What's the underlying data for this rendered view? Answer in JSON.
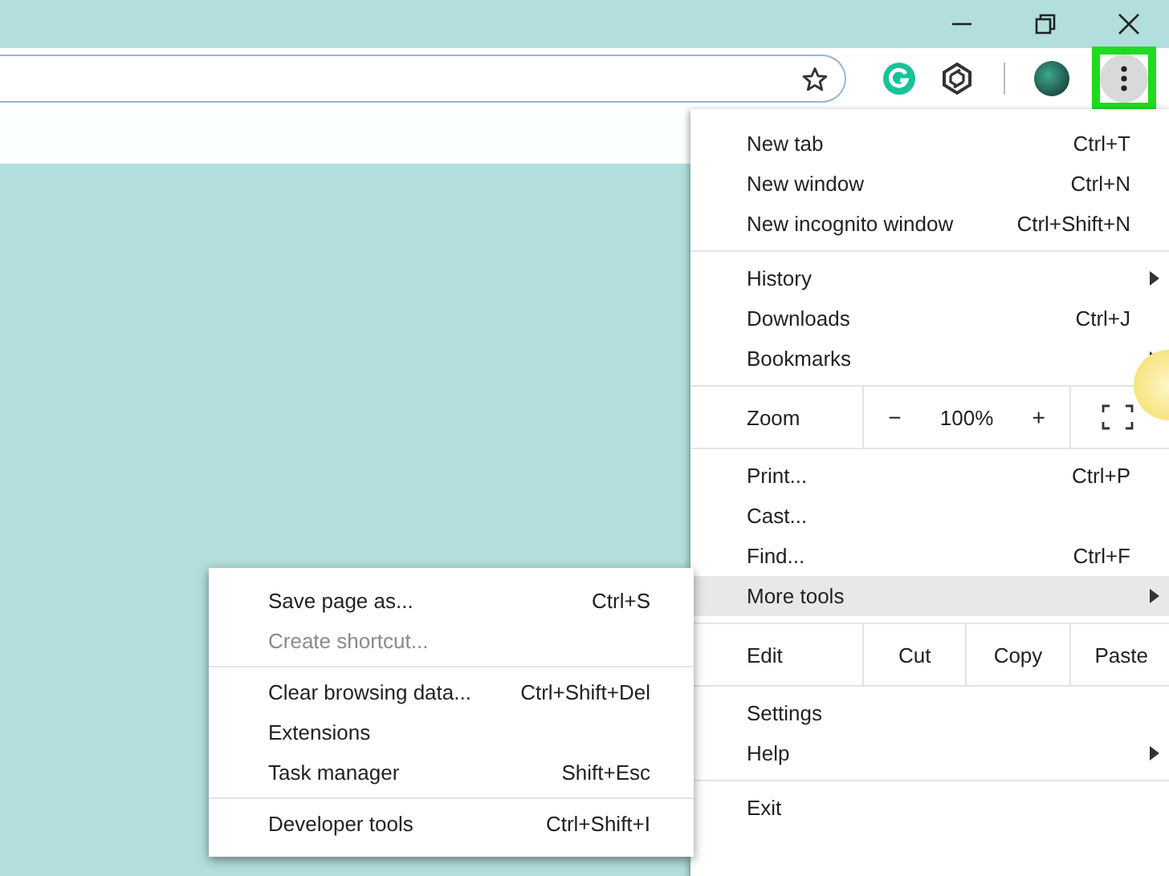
{
  "toolbar": {
    "menu_button": {
      "highlighted": true
    }
  },
  "menu": {
    "sections": [
      [
        {
          "kind": "item",
          "label": "New tab",
          "shortcut": "Ctrl+T",
          "submenu": false,
          "selected": false
        },
        {
          "kind": "item",
          "label": "New window",
          "shortcut": "Ctrl+N",
          "submenu": false,
          "selected": false
        },
        {
          "kind": "item",
          "label": "New incognito window",
          "shortcut": "Ctrl+Shift+N",
          "submenu": false,
          "selected": false
        }
      ],
      [
        {
          "kind": "item",
          "label": "History",
          "submenu": true,
          "selected": false
        },
        {
          "kind": "item",
          "label": "Downloads",
          "shortcut": "Ctrl+J",
          "submenu": false,
          "selected": false
        },
        {
          "kind": "item",
          "label": "Bookmarks",
          "submenu": true,
          "selected": false
        }
      ],
      [
        {
          "kind": "zoom",
          "label": "Zoom",
          "minus": "−",
          "value": "100%",
          "plus": "+"
        }
      ],
      [
        {
          "kind": "item",
          "label": "Print...",
          "shortcut": "Ctrl+P",
          "submenu": false,
          "selected": false
        },
        {
          "kind": "item",
          "label": "Cast...",
          "submenu": false,
          "selected": false
        },
        {
          "kind": "item",
          "label": "Find...",
          "shortcut": "Ctrl+F",
          "submenu": false,
          "selected": false
        },
        {
          "kind": "item",
          "label": "More tools",
          "submenu": true,
          "selected": true
        }
      ],
      [
        {
          "kind": "edit",
          "label": "Edit",
          "actions": [
            "Cut",
            "Copy",
            "Paste"
          ]
        }
      ],
      [
        {
          "kind": "item",
          "label": "Settings",
          "submenu": false,
          "selected": false
        },
        {
          "kind": "item",
          "label": "Help",
          "submenu": true,
          "selected": false
        }
      ],
      [
        {
          "kind": "item",
          "label": "Exit",
          "submenu": false,
          "selected": false
        }
      ]
    ]
  },
  "submenu": {
    "sections": [
      [
        {
          "label": "Save page as...",
          "shortcut": "Ctrl+S",
          "disabled": false
        },
        {
          "label": "Create shortcut...",
          "disabled": true
        }
      ],
      [
        {
          "label": "Clear browsing data...",
          "shortcut": "Ctrl+Shift+Del",
          "disabled": false
        },
        {
          "label": "Extensions",
          "disabled": false
        },
        {
          "label": "Task manager",
          "shortcut": "Shift+Esc",
          "disabled": false
        }
      ],
      [
        {
          "label": "Developer tools",
          "shortcut": "Ctrl+Shift+I",
          "disabled": false
        }
      ]
    ]
  }
}
